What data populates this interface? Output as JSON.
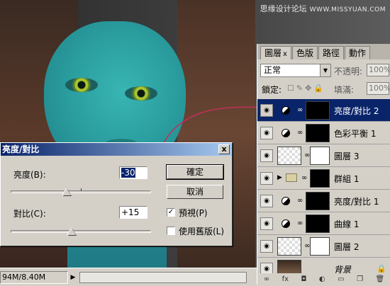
{
  "watermark": {
    "text": "思缘设计论坛",
    "sub": "WWW.MISSYUAN.COM"
  },
  "status": {
    "size": "94M/8.40M",
    "arrow": "▶"
  },
  "dialog": {
    "title": "亮度/對比",
    "close": "x",
    "brightness_label": "亮度(B):",
    "brightness_value": "-30",
    "contrast_label": "對比(C):",
    "contrast_value": "+15",
    "ok_label": "確定",
    "cancel_label": "取消",
    "preview_label": "預視(P)",
    "legacy_label": "使用舊版(L)",
    "preview_checked": "✓",
    "brightness_level": -30,
    "contrast_level": 15
  },
  "panel": {
    "tabs": [
      {
        "label": "圖層",
        "close": "x"
      },
      {
        "label": "色版"
      },
      {
        "label": "路徑"
      },
      {
        "label": "動作"
      }
    ],
    "blend_mode": "正常",
    "opacity_label": "不透明:",
    "opacity_value": "100%",
    "lock_label": "鎖定:",
    "fill_label": "填滿:",
    "fill_value": "100%",
    "layers": [
      {
        "name": "亮度/對比 2",
        "selected": true
      },
      {
        "name": "色彩平衡 1"
      },
      {
        "name": "圖層 3"
      },
      {
        "name": "群組 1"
      },
      {
        "name": "亮度/對比 1"
      },
      {
        "name": "曲線 1"
      },
      {
        "name": "圖層 2"
      },
      {
        "name": "背景"
      }
    ],
    "bottom_icons": [
      "link-icon",
      "fx-icon",
      "mask-icon",
      "adjustment-icon",
      "folder-icon",
      "new-layer-icon",
      "trash-icon"
    ]
  }
}
